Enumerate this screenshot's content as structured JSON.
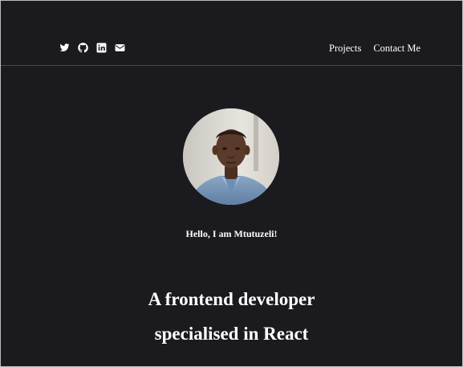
{
  "header": {
    "social_icons": [
      "twitter-icon",
      "github-icon",
      "linkedin-icon",
      "envelope-icon"
    ],
    "nav": {
      "projects_label": "Projects",
      "contact_label": "Contact Me"
    }
  },
  "hero": {
    "greeting": "Hello, I am Mtutuzeli!",
    "headline_line1": "A frontend developer",
    "headline_line2": "specialised in React"
  },
  "colors": {
    "background": "#1b1a1f",
    "text": "#ffffff",
    "divider": "#4a494f"
  }
}
